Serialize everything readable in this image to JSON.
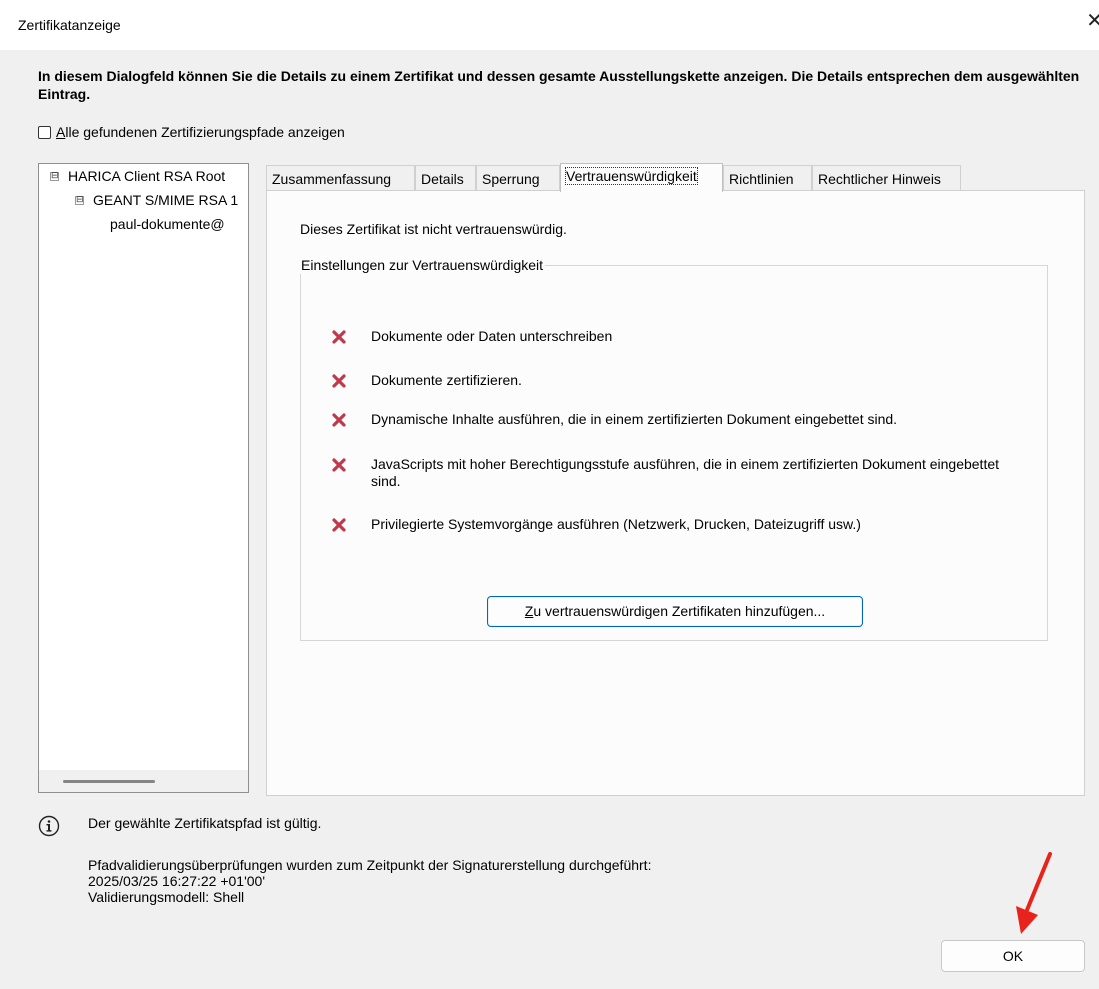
{
  "window": {
    "title": "Zertifikatanzeige",
    "close_glyph": "✕"
  },
  "intro_text": "In diesem Dialogfeld können Sie die Details zu einem Zertifikat und dessen gesamte Ausstellungskette anzeigen. Die Details entsprechen dem ausgewählten Eintrag.",
  "show_all_paths": {
    "label_accesskey": "A",
    "label_rest": "lle gefundenen Zertifizierungspfade anzeigen",
    "checked": false
  },
  "tree": {
    "items": [
      {
        "label": "HARICA Client RSA Root",
        "expander": "⊟"
      },
      {
        "label": "GEANT S/MIME RSA 1",
        "expander": "⊟"
      },
      {
        "label": "paul-dokumente@"
      }
    ]
  },
  "tabs": [
    {
      "label": "Zusammenfassung"
    },
    {
      "label": "Details"
    },
    {
      "label": "Sperrung"
    },
    {
      "label": "Vertrauenswürdigkeit",
      "active": true
    },
    {
      "label": "Richtlinien"
    },
    {
      "label": "Rechtlicher Hinweis"
    }
  ],
  "trust": {
    "status": "Dieses Zertifikat ist nicht vertrauenswürdig.",
    "group_title": "Einstellungen zur Vertrauenswürdigkeit",
    "permissions": [
      {
        "label": "Dokumente oder Daten unterschreiben",
        "icon": "x-icon"
      },
      {
        "label": "Dokumente zertifizieren.",
        "icon": "x-icon"
      },
      {
        "label": "Dynamische Inhalte ausführen, die in einem zertifizierten Dokument eingebettet sind.",
        "icon": "x-icon"
      },
      {
        "label": "JavaScripts mit hoher Berechtigungsstufe ausführen, die in einem zertifizierten Dokument eingebettet sind.",
        "icon": "x-icon"
      },
      {
        "label": "Privilegierte Systemvorgänge ausführen (Netzwerk, Drucken, Dateizugriff usw.)",
        "icon": "x-icon"
      }
    ],
    "add_button_accesskey": "Z",
    "add_button_rest": "u vertrauenswürdigen Zertifikaten hinzufügen..."
  },
  "validation": {
    "path_status": "Der gewählte Zertifikatspfad ist gültig.",
    "checks_line": "Pfadvalidierungsüberprüfungen wurden zum Zeitpunkt der Signaturerstellung durchgeführt:",
    "timestamp": "2025/03/25 16:27:22 +01'00'",
    "model": "Validierungsmodell: Shell"
  },
  "ok_button": "OK",
  "colors": {
    "x_icon": "#c0394b",
    "annotation_arrow": "#e8231c",
    "accent_border": "#0067c0"
  }
}
